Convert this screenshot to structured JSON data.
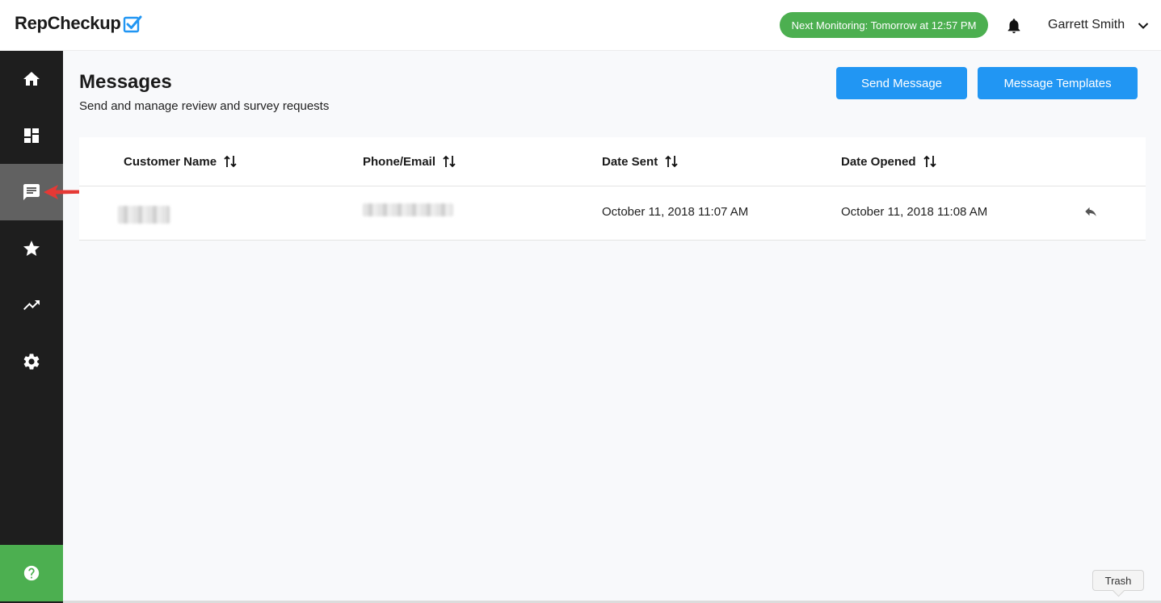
{
  "app": {
    "logo_text": "RepCheckup"
  },
  "header": {
    "monitoring_badge": "Next Monitoring: Tomorrow at 12:57 PM",
    "user_name": "Garrett Smith",
    "accent_color": "#4caf50"
  },
  "sidebar": {
    "items": [
      {
        "icon": "home-icon",
        "active": false
      },
      {
        "icon": "dashboard-icon",
        "active": false
      },
      {
        "icon": "messages-icon",
        "active": true
      },
      {
        "icon": "star-icon",
        "active": false
      },
      {
        "icon": "trending-up-icon",
        "active": false
      },
      {
        "icon": "settings-icon",
        "active": false
      }
    ],
    "help_icon": "help-icon"
  },
  "page": {
    "title": "Messages",
    "subtitle": "Send and manage review and survey requests",
    "send_button": "Send Message",
    "templates_button": "Message Templates",
    "button_color": "#2196f3"
  },
  "table": {
    "columns": [
      "Customer Name",
      "Phone/Email",
      "Date Sent",
      "Date Opened"
    ],
    "rows": [
      {
        "customer_name": "",
        "phone_email": "",
        "date_sent": "October 11, 2018 11:07 AM",
        "date_opened": "October 11, 2018 11:08 AM"
      }
    ]
  },
  "tooltip": {
    "trash": "Trash"
  }
}
